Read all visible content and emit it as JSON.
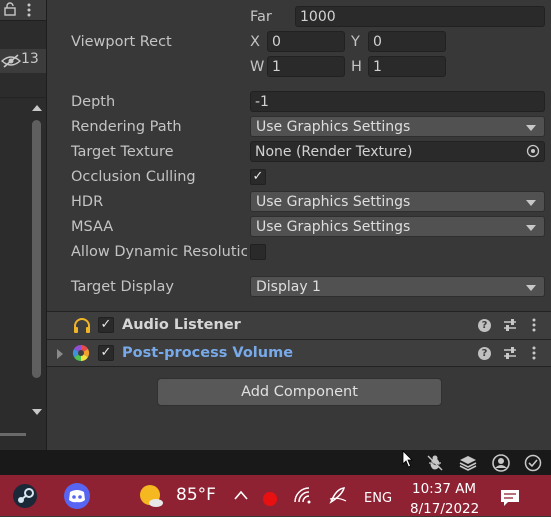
{
  "camera": {
    "far_label": "Far",
    "far_value": "1000",
    "viewport_rect_label": "Viewport Rect",
    "x_label": "X",
    "x_value": "0",
    "y_label": "Y",
    "y_value": "0",
    "w_label": "W",
    "w_value": "1",
    "h_label": "H",
    "h_value": "1",
    "depth_label": "Depth",
    "depth_value": "-1",
    "rendering_path_label": "Rendering Path",
    "rendering_path_value": "Use Graphics Settings",
    "target_texture_label": "Target Texture",
    "target_texture_value": "None (Render Texture)",
    "occlusion_culling_label": "Occlusion Culling",
    "occlusion_culling_checked": true,
    "hdr_label": "HDR",
    "hdr_value": "Use Graphics Settings",
    "msaa_label": "MSAA",
    "msaa_value": "Use Graphics Settings",
    "allow_dynamic_label": "Allow Dynamic Resolutic",
    "allow_dynamic_checked": false,
    "target_display_label": "Target Display",
    "target_display_value": "Display 1"
  },
  "left_panel": {
    "hidden_count": "13"
  },
  "components": [
    {
      "name": "Audio Listener",
      "icon": "headphones-icon",
      "enabled": true,
      "color": "#d6d6d6"
    },
    {
      "name": "Post-process Volume",
      "icon": "camera-aperture-icon",
      "enabled": true,
      "color": "#78a9e8"
    }
  ],
  "add_component_label": "Add Component",
  "taskbar": {
    "temperature": "85°F",
    "language": "ENG",
    "time": "10:37 AM",
    "date": "8/17/2022",
    "icons": [
      "steam-icon",
      "discord-icon",
      "weather-sun-icon",
      "chevron-up-icon",
      "record-icon",
      "wifi-icon",
      "pen-icon",
      "notification-icon"
    ]
  },
  "colors": {
    "taskbar": "#8e2233",
    "link_blue": "#78a9e8",
    "inspector_bg": "#383838"
  }
}
